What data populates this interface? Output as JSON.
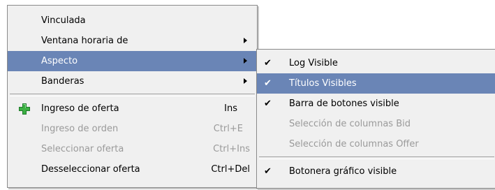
{
  "main_menu": {
    "items": [
      {
        "label": "Vinculada",
        "state": "normal"
      },
      {
        "label": "Ventana horaria de",
        "state": "normal",
        "submenu": true
      },
      {
        "label": "Aspecto",
        "state": "highlighted",
        "submenu": true
      },
      {
        "label": "Banderas",
        "state": "normal",
        "submenu": true
      },
      {
        "label": "Ingreso de oferta",
        "shortcut": "Ins",
        "icon": "green-plus-icon",
        "state": "normal"
      },
      {
        "label": "Ingreso de orden",
        "shortcut": "Ctrl+E",
        "state": "disabled"
      },
      {
        "label": "Seleccionar oferta",
        "shortcut": "Ctrl+Ins",
        "state": "disabled"
      },
      {
        "label": "Desseleccionar oferta",
        "shortcut": "Ctrl+Del",
        "state": "normal"
      }
    ]
  },
  "sub_menu": {
    "items": [
      {
        "label": "Log Visible",
        "checked": true,
        "state": "normal"
      },
      {
        "label": "Títulos Visibles",
        "checked": true,
        "state": "highlighted"
      },
      {
        "label": "Barra de botones visible",
        "checked": true,
        "state": "normal"
      },
      {
        "label": "Selección de columnas Bid",
        "checked": false,
        "state": "disabled"
      },
      {
        "label": "Selección de columnas Offer",
        "checked": false,
        "state": "disabled"
      },
      {
        "label": "Botonera gráfico visible",
        "checked": true,
        "state": "normal"
      }
    ]
  },
  "check_glyph": "✔",
  "colors": {
    "highlight": "#6a85b6",
    "menu_bg": "#f0f0f0",
    "disabled_text": "#9a9a9a",
    "plus_icon": "#3cb043"
  }
}
